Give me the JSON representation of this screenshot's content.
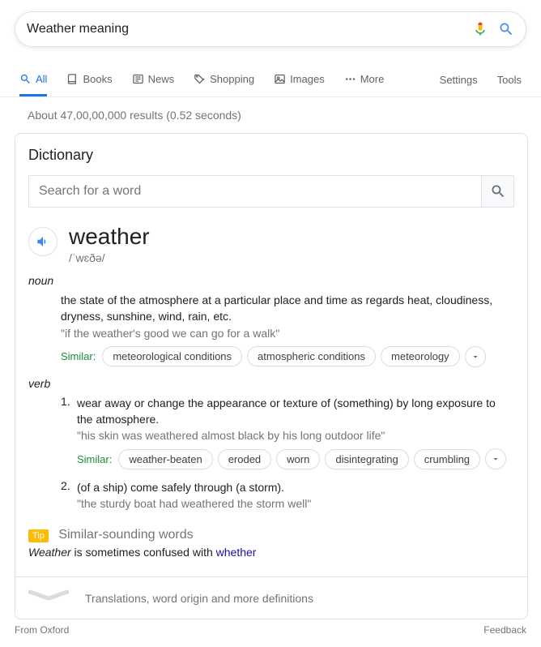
{
  "search": {
    "query": "Weather meaning",
    "placeholder": ""
  },
  "tabs": [
    {
      "label": "All"
    },
    {
      "label": "Books"
    },
    {
      "label": "News"
    },
    {
      "label": "Shopping"
    },
    {
      "label": "Images"
    },
    {
      "label": "More"
    }
  ],
  "settings": "Settings",
  "tools": "Tools",
  "result_stats": "About 47,00,00,000 results (0.52 seconds)",
  "card": {
    "title": "Dictionary",
    "search_placeholder": "Search for a word",
    "word": "weather",
    "phonetic": "/ˈwɛðə/",
    "pos_noun": "noun",
    "noun_def": "the state of the atmosphere at a particular place and time as regards heat, cloudiness, dryness, sunshine, wind, rain, etc.",
    "noun_example": "\"if the weather's good we can go for a walk\"",
    "similar_label": "Similar:",
    "noun_similar": [
      {
        "text": "meteorological conditions"
      },
      {
        "text": "atmospheric conditions"
      },
      {
        "text": "meteorology"
      }
    ],
    "pos_verb": "verb",
    "verb1_num": "1.",
    "verb1_def": "wear away or change the appearance or texture of (something) by long exposure to the atmosphere.",
    "verb1_example": "\"his skin was weathered almost black by his long outdoor life\"",
    "verb1_similar": [
      {
        "text": "weather-beaten"
      },
      {
        "text": "eroded"
      },
      {
        "text": "worn"
      },
      {
        "text": "disintegrating"
      },
      {
        "text": "crumbling"
      }
    ],
    "verb2_num": "2.",
    "verb2_def": "(of a ship) come safely through (a storm).",
    "verb2_example": "\"the sturdy boat had weathered the storm well\"",
    "tip_badge": "Tip",
    "tip_title": "Similar-sounding words",
    "tip_word": "Weather",
    "tip_mid": " is sometimes confused with ",
    "tip_link": "whether",
    "expand_label": "Translations, word origin and more definitions"
  },
  "source": "From Oxford",
  "feedback": "Feedback"
}
